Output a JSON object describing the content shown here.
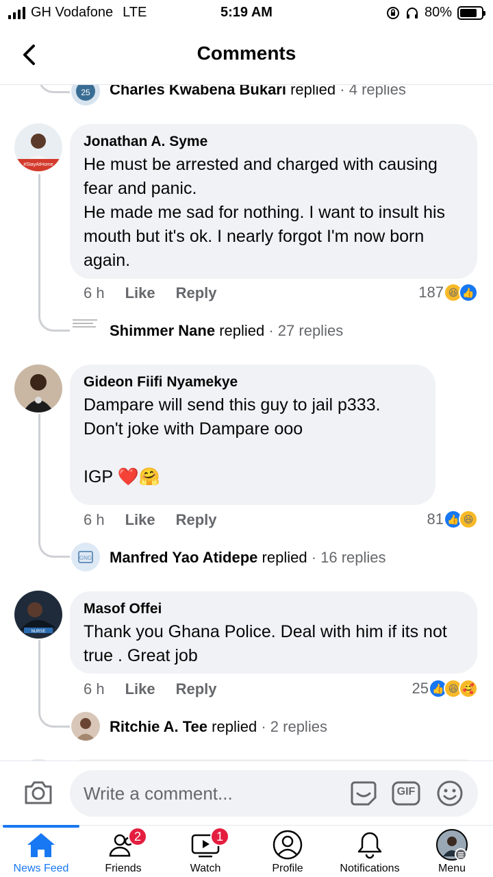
{
  "status_bar": {
    "carrier": "GH Vodafone",
    "network": "LTE",
    "time": "5:19 AM",
    "battery": "80%",
    "battery_level": 0.8
  },
  "header": {
    "title": "Comments"
  },
  "top_reply_summary": {
    "name": "Charles Kwabena Bukari",
    "verb": "replied",
    "meta": "· 4 replies"
  },
  "comments": [
    {
      "author": "Jonathan A. Syme",
      "text": "He must be arrested and charged with causing fear and panic.\nHe made me sad for nothing. I want to insult his mouth but it's ok. I nearly forgot I'm now born again.",
      "time": "6 h",
      "like_label": "Like",
      "reply_label": "Reply",
      "reaction_count": "187",
      "reactions": [
        "haha",
        "like"
      ],
      "reply_summary": {
        "name": "Shimmer Nane",
        "verb": "replied",
        "meta": "· 27 replies"
      }
    },
    {
      "author": "Gideon Fiifi Nyamekye",
      "text": "Dampare will send this guy to jail p333.\nDon't joke with Dampare ooo\n\nIGP ❤️🤗",
      "time": "6 h",
      "like_label": "Like",
      "reply_label": "Reply",
      "reaction_count": "81",
      "reactions": [
        "like",
        "haha"
      ],
      "reply_summary": {
        "name": "Manfred Yao Atidepe",
        "verb": "replied",
        "meta": "· 16 replies"
      }
    },
    {
      "author": "Masof Offei",
      "text": "Thank you Ghana Police.  Deal with him if its not true . Great job",
      "time": "6 h",
      "like_label": "Like",
      "reply_label": "Reply",
      "reaction_count": "25",
      "reactions": [
        "like",
        "haha",
        "care"
      ],
      "reply_summary": {
        "name": "Ritchie A. Tee",
        "verb": "replied",
        "meta": "· 2 replies"
      }
    }
  ],
  "composer": {
    "placeholder": "Write a comment...",
    "gif_label": "GIF"
  },
  "bottom_nav": [
    {
      "label": "News Feed",
      "icon": "home-icon",
      "active": true
    },
    {
      "label": "Friends",
      "icon": "friends-icon",
      "badge": "2"
    },
    {
      "label": "Watch",
      "icon": "watch-icon",
      "badge": "1"
    },
    {
      "label": "Profile",
      "icon": "profile-icon"
    },
    {
      "label": "Notifications",
      "icon": "bell-icon"
    },
    {
      "label": "Menu",
      "icon": "menu-avatar-icon"
    }
  ],
  "colors": {
    "accent": "#1877f2",
    "bubble": "#f0f2f5",
    "muted_text": "#65676b",
    "badge": "#e41e3f"
  }
}
